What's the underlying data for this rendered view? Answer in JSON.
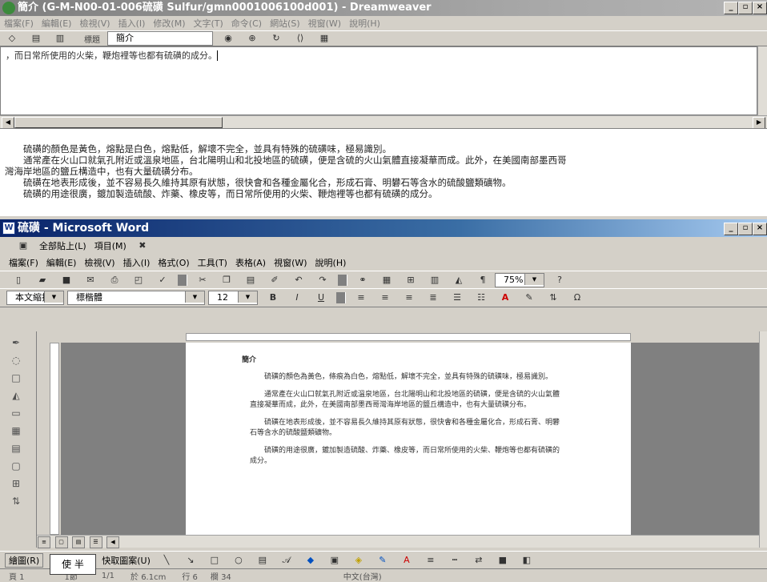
{
  "dreamweaver": {
    "title": "簡介 (G-M-N00-01-006硫磺 Sulfur/gmn0001006100d001) - Dreamweaver",
    "menu": [
      "檔案(F)",
      "編輯(E)",
      "檢視(V)",
      "插入(I)",
      "修改(M)",
      "文字(T)",
      "命令(C)",
      "網站(S)",
      "視窗(W)",
      "說明(H)"
    ],
    "toolbar": {
      "title_label": "標題",
      "title_value": "簡介"
    },
    "code_line": "，而日常所使用的火柴，鞭炮裡等也都有硫磺的成分。",
    "design_paragraphs": [
      "　　硫磺的顏色是黃色，熔點是白色，熔點低，解壞不完全，並具有特殊的硫磺味，極易識別。",
      "　　通常產在火山口就氣孔附近或溫泉地區，台北陽明山和北投地區的硫磺，便是含硫的火山氣體直接凝華而成。此外，在美國南部墨西哥",
      "灣海岸地區的鹽丘構造中，也有大量硫磺分布。",
      "　　硫磺在地表形成後，並不容易長久維持其原有狀態，很快會和各種金屬化合，形成石膏、明礬石等含水的硫酸鹽類礦物。",
      "　　硫磺的用途很廣，鍍加製造硫酸、炸藥、橡皮等，而日常所使用的火柴、鞭炮裡等也都有硫磺的成分。"
    ]
  },
  "word": {
    "title": "硫磺 - Microsoft Word",
    "clipboard": {
      "paste_all": "全部貼上(L)",
      "items": "項目(M)"
    },
    "menu": [
      "檔案(F)",
      "編輯(E)",
      "檢視(V)",
      "插入(I)",
      "格式(O)",
      "工具(T)",
      "表格(A)",
      "視窗(W)",
      "說明(H)"
    ],
    "zoom": "75%",
    "style": "本文縮排",
    "font": "標楷體",
    "size": "12",
    "page_heading": "簡介",
    "page_paragraphs": [
      "　　硫磺的顏色為黃色，條痕為白色，熔點低，解壞不完全，並具有特殊的硫磺味，極易識別。",
      "　　通常產在火山口就氣孔附近或溫泉地區，台北陽明山和北投地區的硫磺，便是含硫的火山氣體直接凝華而成，此外，在美國南部墨西哥灣海岸地區的鹽丘構造中，也有大量硫磺分布。",
      "　　硫磺在地表形成後，並不容易長久維持其原有狀態，很快會和各種金屬化合，形成石膏、明礬石等含水的硫酸鹽類礦物。",
      "　　硫磺的用途很廣，鍍加製造硫酸、炸藥、橡皮等，而日常所使用的火柴、鞭炮等也都有硫磺的成分。"
    ],
    "drawing": {
      "draw_label": "繪圖(R)",
      "autoshapes": "快取圖案(U)"
    },
    "ime": "使 半",
    "status": {
      "page": "頁 1",
      "section": "1節",
      "position": "1/1",
      "at": "於 6.1cm",
      "line": "行 6",
      "col": "欄 34",
      "lang": "中文(台灣)"
    }
  }
}
